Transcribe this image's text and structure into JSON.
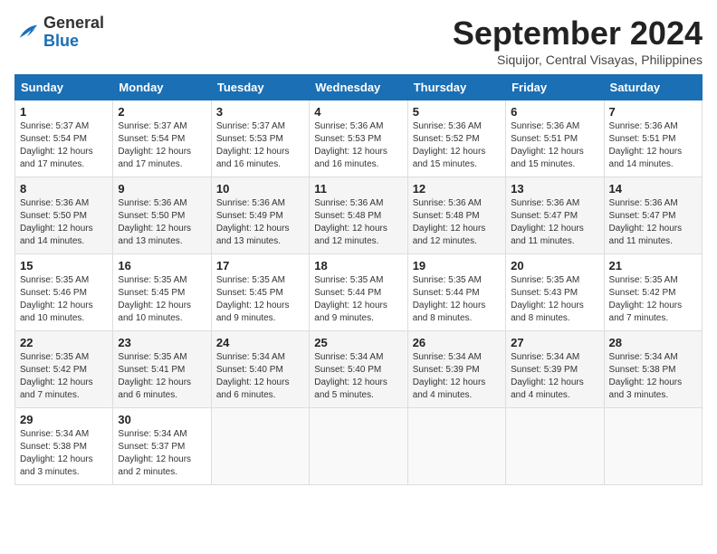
{
  "logo": {
    "general": "General",
    "blue": "Blue"
  },
  "header": {
    "month_title": "September 2024",
    "subtitle": "Siquijor, Central Visayas, Philippines"
  },
  "weekdays": [
    "Sunday",
    "Monday",
    "Tuesday",
    "Wednesday",
    "Thursday",
    "Friday",
    "Saturday"
  ],
  "weeks": [
    [
      {
        "day": "1",
        "lines": [
          "Sunrise: 5:37 AM",
          "Sunset: 5:54 PM",
          "Daylight: 12 hours",
          "and 17 minutes."
        ]
      },
      {
        "day": "2",
        "lines": [
          "Sunrise: 5:37 AM",
          "Sunset: 5:54 PM",
          "Daylight: 12 hours",
          "and 17 minutes."
        ]
      },
      {
        "day": "3",
        "lines": [
          "Sunrise: 5:37 AM",
          "Sunset: 5:53 PM",
          "Daylight: 12 hours",
          "and 16 minutes."
        ]
      },
      {
        "day": "4",
        "lines": [
          "Sunrise: 5:36 AM",
          "Sunset: 5:53 PM",
          "Daylight: 12 hours",
          "and 16 minutes."
        ]
      },
      {
        "day": "5",
        "lines": [
          "Sunrise: 5:36 AM",
          "Sunset: 5:52 PM",
          "Daylight: 12 hours",
          "and 15 minutes."
        ]
      },
      {
        "day": "6",
        "lines": [
          "Sunrise: 5:36 AM",
          "Sunset: 5:51 PM",
          "Daylight: 12 hours",
          "and 15 minutes."
        ]
      },
      {
        "day": "7",
        "lines": [
          "Sunrise: 5:36 AM",
          "Sunset: 5:51 PM",
          "Daylight: 12 hours",
          "and 14 minutes."
        ]
      }
    ],
    [
      {
        "day": "8",
        "lines": [
          "Sunrise: 5:36 AM",
          "Sunset: 5:50 PM",
          "Daylight: 12 hours",
          "and 14 minutes."
        ]
      },
      {
        "day": "9",
        "lines": [
          "Sunrise: 5:36 AM",
          "Sunset: 5:50 PM",
          "Daylight: 12 hours",
          "and 13 minutes."
        ]
      },
      {
        "day": "10",
        "lines": [
          "Sunrise: 5:36 AM",
          "Sunset: 5:49 PM",
          "Daylight: 12 hours",
          "and 13 minutes."
        ]
      },
      {
        "day": "11",
        "lines": [
          "Sunrise: 5:36 AM",
          "Sunset: 5:48 PM",
          "Daylight: 12 hours",
          "and 12 minutes."
        ]
      },
      {
        "day": "12",
        "lines": [
          "Sunrise: 5:36 AM",
          "Sunset: 5:48 PM",
          "Daylight: 12 hours",
          "and 12 minutes."
        ]
      },
      {
        "day": "13",
        "lines": [
          "Sunrise: 5:36 AM",
          "Sunset: 5:47 PM",
          "Daylight: 12 hours",
          "and 11 minutes."
        ]
      },
      {
        "day": "14",
        "lines": [
          "Sunrise: 5:36 AM",
          "Sunset: 5:47 PM",
          "Daylight: 12 hours",
          "and 11 minutes."
        ]
      }
    ],
    [
      {
        "day": "15",
        "lines": [
          "Sunrise: 5:35 AM",
          "Sunset: 5:46 PM",
          "Daylight: 12 hours",
          "and 10 minutes."
        ]
      },
      {
        "day": "16",
        "lines": [
          "Sunrise: 5:35 AM",
          "Sunset: 5:45 PM",
          "Daylight: 12 hours",
          "and 10 minutes."
        ]
      },
      {
        "day": "17",
        "lines": [
          "Sunrise: 5:35 AM",
          "Sunset: 5:45 PM",
          "Daylight: 12 hours",
          "and 9 minutes."
        ]
      },
      {
        "day": "18",
        "lines": [
          "Sunrise: 5:35 AM",
          "Sunset: 5:44 PM",
          "Daylight: 12 hours",
          "and 9 minutes."
        ]
      },
      {
        "day": "19",
        "lines": [
          "Sunrise: 5:35 AM",
          "Sunset: 5:44 PM",
          "Daylight: 12 hours",
          "and 8 minutes."
        ]
      },
      {
        "day": "20",
        "lines": [
          "Sunrise: 5:35 AM",
          "Sunset: 5:43 PM",
          "Daylight: 12 hours",
          "and 8 minutes."
        ]
      },
      {
        "day": "21",
        "lines": [
          "Sunrise: 5:35 AM",
          "Sunset: 5:42 PM",
          "Daylight: 12 hours",
          "and 7 minutes."
        ]
      }
    ],
    [
      {
        "day": "22",
        "lines": [
          "Sunrise: 5:35 AM",
          "Sunset: 5:42 PM",
          "Daylight: 12 hours",
          "and 7 minutes."
        ]
      },
      {
        "day": "23",
        "lines": [
          "Sunrise: 5:35 AM",
          "Sunset: 5:41 PM",
          "Daylight: 12 hours",
          "and 6 minutes."
        ]
      },
      {
        "day": "24",
        "lines": [
          "Sunrise: 5:34 AM",
          "Sunset: 5:40 PM",
          "Daylight: 12 hours",
          "and 6 minutes."
        ]
      },
      {
        "day": "25",
        "lines": [
          "Sunrise: 5:34 AM",
          "Sunset: 5:40 PM",
          "Daylight: 12 hours",
          "and 5 minutes."
        ]
      },
      {
        "day": "26",
        "lines": [
          "Sunrise: 5:34 AM",
          "Sunset: 5:39 PM",
          "Daylight: 12 hours",
          "and 4 minutes."
        ]
      },
      {
        "day": "27",
        "lines": [
          "Sunrise: 5:34 AM",
          "Sunset: 5:39 PM",
          "Daylight: 12 hours",
          "and 4 minutes."
        ]
      },
      {
        "day": "28",
        "lines": [
          "Sunrise: 5:34 AM",
          "Sunset: 5:38 PM",
          "Daylight: 12 hours",
          "and 3 minutes."
        ]
      }
    ],
    [
      {
        "day": "29",
        "lines": [
          "Sunrise: 5:34 AM",
          "Sunset: 5:38 PM",
          "Daylight: 12 hours",
          "and 3 minutes."
        ]
      },
      {
        "day": "30",
        "lines": [
          "Sunrise: 5:34 AM",
          "Sunset: 5:37 PM",
          "Daylight: 12 hours",
          "and 2 minutes."
        ]
      },
      {
        "day": "",
        "lines": []
      },
      {
        "day": "",
        "lines": []
      },
      {
        "day": "",
        "lines": []
      },
      {
        "day": "",
        "lines": []
      },
      {
        "day": "",
        "lines": []
      }
    ]
  ]
}
